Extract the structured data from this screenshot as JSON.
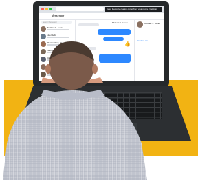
{
  "screen": {
    "banner_text": "Keep the conversation going from your phone. Get App",
    "messenger_title": "Messenger",
    "search_placeholder": "Search Messenger",
    "chat_contact_name": "Michael S. Lucas",
    "contacts": [
      {
        "name": "Michael S. Lucas"
      },
      {
        "name": "Joel Soltz"
      },
      {
        "name": "Ronnie Sam, Jamie Dean"
      },
      {
        "name": "Sam Bibi"
      },
      {
        "name": "Corey"
      },
      {
        "name": "Ronnie"
      },
      {
        "name": "Lucia"
      }
    ],
    "info_name": "Michael S. Lucas",
    "info_link": "facebook.com"
  },
  "colors": {
    "background_accent": "#f2b313",
    "laptop": "#26292b",
    "messenger_blue": "#2d88ff"
  },
  "icons": [
    "thumbs-up-icon",
    "search-icon"
  ]
}
